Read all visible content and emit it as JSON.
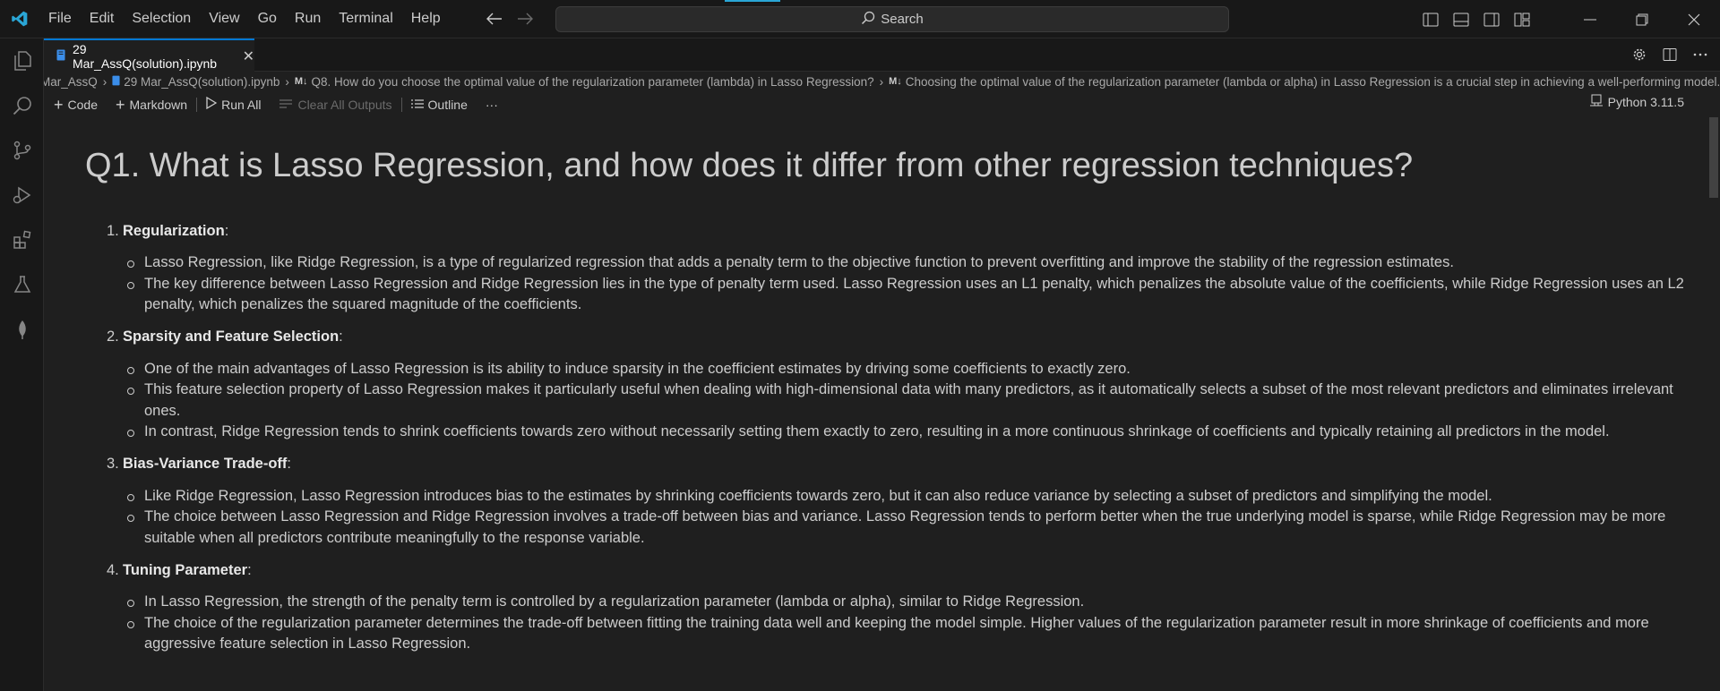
{
  "menu": [
    "File",
    "Edit",
    "Selection",
    "View",
    "Go",
    "Run",
    "Terminal",
    "Help"
  ],
  "search": {
    "label": "Search"
  },
  "tab": {
    "title": "29 Mar_AssQ(solution).ipynb"
  },
  "breadcrumb": {
    "folder": "Mar_AssQ",
    "file": "29 Mar_AssQ(solution).ipynb",
    "md_glyph": "M↓",
    "cell1": "Q8. How do you choose the optimal value of the regularization parameter (lambda) in Lasso Regression?",
    "cell2": "Choosing the optimal value of the regularization parameter (lambda or alpha) in Lasso Regression is a crucial step in achieving a well-performing model."
  },
  "toolbar": {
    "code": "Code",
    "markdown": "Markdown",
    "run_all": "Run All",
    "clear_outputs": "Clear All Outputs",
    "outline": "Outline",
    "more": "···",
    "kernel": "Python 3.11.5"
  },
  "cell": {
    "heading": "Q1. What is Lasso Regression, and how does it differ from other regression techniques?",
    "items": [
      {
        "num": "1.",
        "title": "Regularization",
        "bullets": [
          "Lasso Regression, like Ridge Regression, is a type of regularized regression that adds a penalty term to the objective function to prevent overfitting and improve the stability of the regression estimates.",
          "The key difference between Lasso Regression and Ridge Regression lies in the type of penalty term used. Lasso Regression uses an L1 penalty, which penalizes the absolute value of the coefficients, while Ridge Regression uses an L2 penalty, which penalizes the squared magnitude of the coefficients."
        ]
      },
      {
        "num": "2.",
        "title": "Sparsity and Feature Selection",
        "bullets": [
          "One of the main advantages of Lasso Regression is its ability to induce sparsity in the coefficient estimates by driving some coefficients to exactly zero.",
          "This feature selection property of Lasso Regression makes it particularly useful when dealing with high-dimensional data with many predictors, as it automatically selects a subset of the most relevant predictors and eliminates irrelevant ones.",
          "In contrast, Ridge Regression tends to shrink coefficients towards zero without necessarily setting them exactly to zero, resulting in a more continuous shrinkage of coefficients and typically retaining all predictors in the model."
        ]
      },
      {
        "num": "3.",
        "title": "Bias-Variance Trade-off",
        "bullets": [
          "Like Ridge Regression, Lasso Regression introduces bias to the estimates by shrinking coefficients towards zero, but it can also reduce variance by selecting a subset of predictors and simplifying the model.",
          "The choice between Lasso Regression and Ridge Regression involves a trade-off between bias and variance. Lasso Regression tends to perform better when the true underlying model is sparse, while Ridge Regression may be more suitable when all predictors contribute meaningfully to the response variable."
        ]
      },
      {
        "num": "4.",
        "title": "Tuning Parameter",
        "bullets": [
          "In Lasso Regression, the strength of the penalty term is controlled by a regularization parameter (lambda or alpha), similar to Ridge Regression.",
          "The choice of the regularization parameter determines the trade-off between fitting the training data well and keeping the model simple. Higher values of the regularization parameter result in more shrinkage of coefficients and more aggressive feature selection in Lasso Regression."
        ]
      }
    ]
  },
  "colors": {
    "accent": "#0078d4",
    "vscode_blue": "#2aa6d6",
    "background": "#1f1f1f",
    "chrome": "#181818"
  }
}
